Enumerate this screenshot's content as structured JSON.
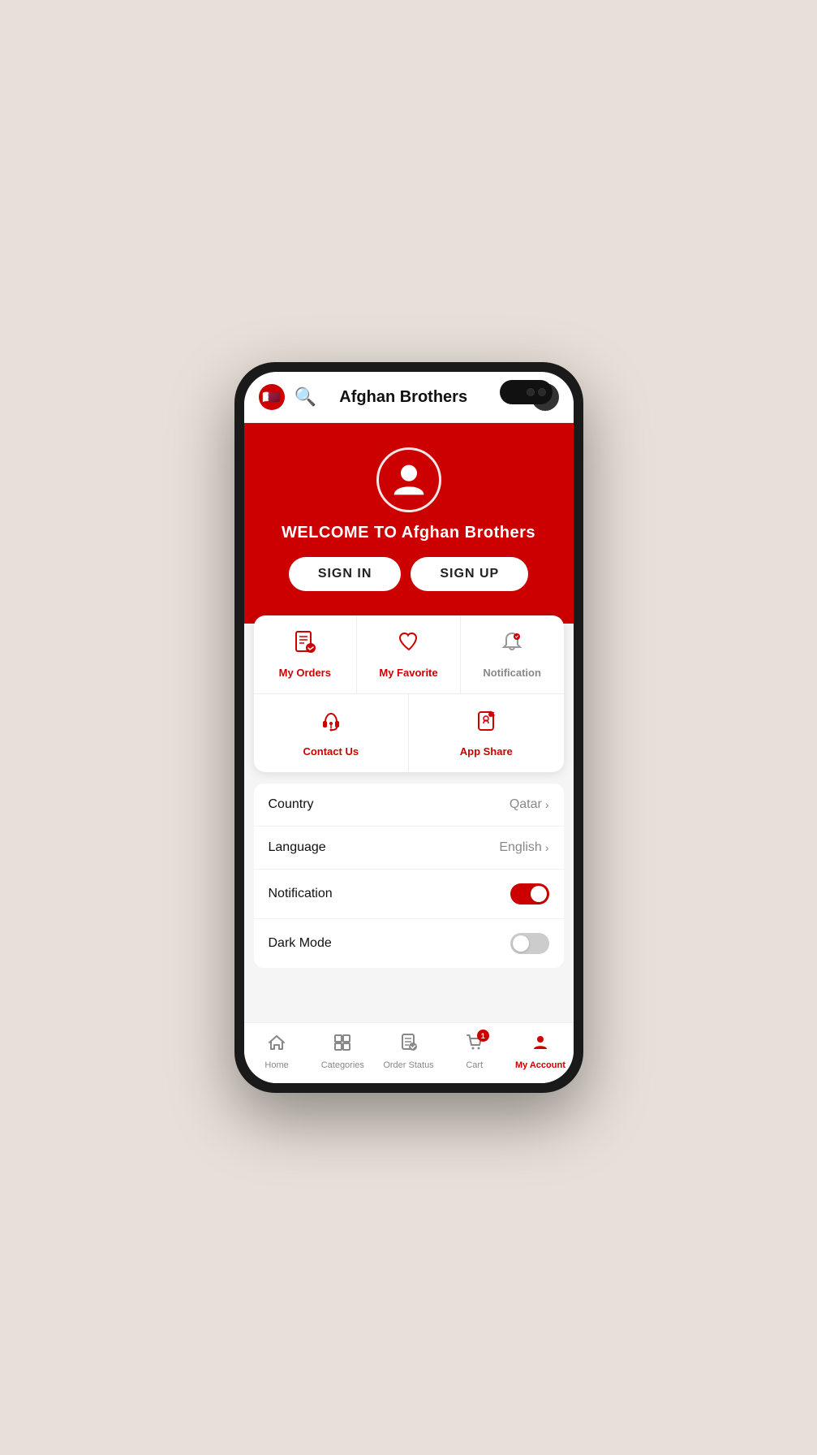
{
  "header": {
    "title": "Afghan Brothers",
    "flag_emoji": "🇶🇦",
    "search_icon": "🔍",
    "avatar_initial": "€"
  },
  "banner": {
    "welcome_text": "WELCOME TO Afghan Brothers",
    "signin_label": "SIGN IN",
    "signup_label": "SIGN UP"
  },
  "menu": {
    "items_top": [
      {
        "label": "My Orders",
        "icon_type": "orders",
        "active": true
      },
      {
        "label": "My Favorite",
        "icon_type": "heart",
        "active": true
      },
      {
        "label": "Notification",
        "icon_type": "bell",
        "active": false
      }
    ],
    "items_bottom": [
      {
        "label": "Contact Us",
        "icon_type": "headset",
        "active": true
      },
      {
        "label": "App Share",
        "icon_type": "share",
        "active": true
      }
    ]
  },
  "settings": {
    "country_label": "Country",
    "country_value": "Qatar",
    "language_label": "Language",
    "language_value": "English",
    "notification_label": "Notification",
    "notification_on": true,
    "darkmode_label": "Dark Mode",
    "darkmode_on": false
  },
  "bottom_nav": {
    "items": [
      {
        "label": "Home",
        "icon": "home",
        "active": false
      },
      {
        "label": "Categories",
        "icon": "categories",
        "active": false
      },
      {
        "label": "Order Status",
        "icon": "order-status",
        "active": false
      },
      {
        "label": "Cart",
        "icon": "cart",
        "active": false,
        "badge": "1"
      },
      {
        "label": "My Account",
        "icon": "account",
        "active": true
      }
    ]
  }
}
